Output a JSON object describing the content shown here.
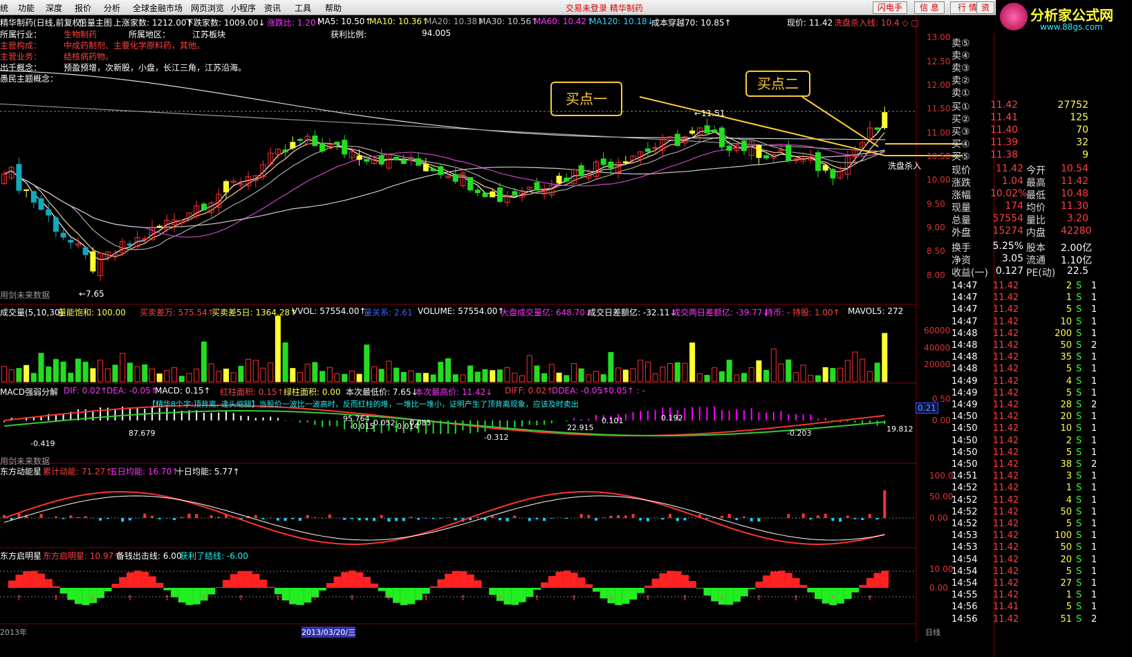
{
  "menu": [
    "统",
    "功能",
    "深度",
    "报价",
    "分析",
    "全球金融市场",
    "网页浏览",
    "小程序",
    "资讯",
    "工具",
    "帮助"
  ],
  "notice": "交易未登录  精华制药",
  "header_buttons": [
    "闪电手",
    "信 息",
    "行 情",
    "资"
  ],
  "logo": {
    "title": "分析家公式网",
    "url": "www.88gs.com"
  },
  "stock_header": {
    "name": "精华制药(日线,前复权)",
    "mult": "倍量主图",
    "up_count": "上涨家数: 1212.00↑",
    "down_count": "下跌家数: 1009.00↓",
    "ratio": "涨跌比: 1.20↑",
    "ma5": "MA5: 10.50↑",
    "ma10": "MA10: 10.36↑",
    "ma20": "MA20: 10.38↑",
    "ma30": "MA30: 10.56↑",
    "ma60": "MA60: 10.42↑",
    "ma120": "MA120: 10.18↓",
    "cost": "成本穿越70: 10.85↑",
    "current": "现价: 11.42",
    "wash": "洗盘杀入线: 10.4 ◇ ▢"
  },
  "info": {
    "industry_label": "所属行业：",
    "industry": "生物制药",
    "region_label": "所属地区：",
    "region": "江苏板块",
    "profit_label": "获利比例:",
    "profit": "94.005",
    "main_label": "主营构成：",
    "main": "中成药制剂、主要化学原料药，其他。",
    "business_label": "主营业务：",
    "business": "结核病药物。",
    "concept_label": "出千概念：",
    "concept": "预盈预增，次新股，小盘，长江三角，江苏沿海。",
    "theme_label": "愚民主题概念："
  },
  "watermark": "用剑未来数据",
  "annotations": {
    "buy1": "买点一",
    "buy2": "买点二",
    "wash_tag": "洗盘杀入",
    "low": "←7.65",
    "high": "←11.51"
  },
  "main_axis": [
    "13.00",
    "12.50",
    "12.00",
    "11.50",
    "11.00",
    "10.50",
    "10.00",
    "9.50",
    "9.00",
    "8.50",
    "8.00"
  ],
  "vol_header": {
    "title": "成交量(5,10,30)",
    "sat": "量能饱和: 100.00",
    "diff": "买卖差万: 575.54↑",
    "diff5": "买卖差5日: 1364.28↑",
    "vvol": "VVOL: 57554.00↑",
    "inflow": "量关系: 2.61",
    "volume": "VOLUME: 57554.00↑",
    "big": "大盘成交量亿: 648.70↓",
    "daydiff": "成交日差额亿: -32.11↓",
    "twoday": "成交两日差额亿: -39.77↓",
    "hold": "持币: -",
    "holdshare": "持股: 1.00↑",
    "mavol": "MAVOL5: 272"
  },
  "vol_axis": [
    "60000",
    "40000",
    "20000"
  ],
  "macd_header": {
    "title": "MACD强弱分解",
    "dif": "DIF: 0.02↑",
    "dea": "DEA: -0.05↑",
    "macd": "MACD: 0.15↑",
    "red": "红柱面积: 0.15↑",
    "green": "绿柱面积: 0.00",
    "low": "本次最低价: 7.65↓",
    "high": "本次最高价: 11.42↓",
    "diff2": "DIFF: 0.02↑",
    "ddea": "DDEA: -0.05↑",
    "extra": ": -0.05↑  : -"
  },
  "macd_note": "【精华8个字:顶背离, 逢头缩腿】当股价一波比一波高时，反而红柱的堆，一堆比一堆小，证明产生了顶背离现象，应该及时卖出",
  "macd_axis": [
    "0.50",
    "0.00"
  ],
  "macd_tag": "0.21",
  "macd_labels": [
    "-0.419",
    "87.679",
    "95.764",
    "-0.015",
    "0.052",
    "-0.014",
    "0.085",
    "-0.312",
    "22.915",
    "0.101",
    "0.192",
    "19.812",
    "-0.203"
  ],
  "dyn_header": {
    "title": "东方动能星",
    "total": "累计动能: 71.27↑",
    "five": "五日均能: 16.70↑",
    "ten": "十日均能: 5.77↑"
  },
  "dyn_axis": [
    "100.0",
    "50.00",
    "0.00"
  ],
  "star_header": {
    "title": "东方启明星",
    "star": "东方启明星: 10.97↑",
    "ready": "备钱出击线: 6.00",
    "profit": "获利了结线: -6.00"
  },
  "star_axis": [
    "10.00",
    "0.00"
  ],
  "bottom": {
    "date": "2013/03/20/三",
    "day": "日线",
    "y1": "2013年"
  },
  "orderbook": {
    "sells": [
      {
        "l": "卖⑤"
      },
      {
        "l": "卖④"
      },
      {
        "l": "卖③"
      },
      {
        "l": "卖②"
      },
      {
        "l": "卖①"
      }
    ],
    "buys": [
      {
        "l": "买①",
        "p": "11.42",
        "v": "27752"
      },
      {
        "l": "买②",
        "p": "11.41",
        "v": "125"
      },
      {
        "l": "买③",
        "p": "11.40",
        "v": "70"
      },
      {
        "l": "买④",
        "p": "11.39",
        "v": "32"
      },
      {
        "l": "买⑤",
        "p": "11.38",
        "v": "9"
      }
    ]
  },
  "quote": [
    {
      "l1": "现价",
      "v1": "11.42",
      "l2": "今开",
      "v2": "10.54"
    },
    {
      "l1": "涨跌",
      "v1": "1.04",
      "l2": "最高",
      "v2": "11.42"
    },
    {
      "l1": "涨幅",
      "v1": "10.02%",
      "l2": "最低",
      "v2": "10.48"
    },
    {
      "l1": "现量",
      "v1": "174",
      "l2": "均价",
      "v2": "11.30"
    },
    {
      "l1": "总量",
      "v1": "57554",
      "l2": "量比",
      "v2": "3.20"
    },
    {
      "l1": "外盘",
      "v1": "15274",
      "l2": "内盘",
      "v2": "42280"
    }
  ],
  "fund": [
    {
      "l1": "换手",
      "v1": "5.25%",
      "l2": "股本",
      "v2": "2.00亿"
    },
    {
      "l1": "净资",
      "v1": "3.05",
      "l2": "流通",
      "v2": "1.10亿"
    },
    {
      "l1": "收益(一)",
      "v1": "0.127",
      "l2": "PE(动)",
      "v2": "22.5"
    }
  ],
  "ticks": [
    {
      "t": "14:47",
      "p": "11.42",
      "v": "2",
      "s": "S",
      "n": "1"
    },
    {
      "t": "14:47",
      "p": "11.42",
      "v": "1",
      "s": "S",
      "n": "1"
    },
    {
      "t": "14:47",
      "p": "11.42",
      "v": "5",
      "s": "S",
      "n": "1"
    },
    {
      "t": "14:47",
      "p": "11.42",
      "v": "10",
      "s": "S",
      "n": "1"
    },
    {
      "t": "14:48",
      "p": "11.42",
      "v": "200",
      "s": "S",
      "n": "1"
    },
    {
      "t": "14:48",
      "p": "11.42",
      "v": "50",
      "s": "S",
      "n": "2"
    },
    {
      "t": "14:48",
      "p": "11.42",
      "v": "35",
      "s": "S",
      "n": "1"
    },
    {
      "t": "14:48",
      "p": "11.42",
      "v": "5",
      "s": "S",
      "n": "1"
    },
    {
      "t": "14:49",
      "p": "11.42",
      "v": "4",
      "s": "S",
      "n": "1"
    },
    {
      "t": "14:49",
      "p": "11.42",
      "v": "5",
      "s": "S",
      "n": "1"
    },
    {
      "t": "14:49",
      "p": "11.42",
      "v": "28",
      "s": "S",
      "n": "2"
    },
    {
      "t": "14:50",
      "p": "11.42",
      "v": "20",
      "s": "S",
      "n": "1"
    },
    {
      "t": "14:50",
      "p": "11.42",
      "v": "10",
      "s": "S",
      "n": "1"
    },
    {
      "t": "14:50",
      "p": "11.42",
      "v": "2",
      "s": "S",
      "n": "1"
    },
    {
      "t": "14:50",
      "p": "11.42",
      "v": "5",
      "s": "S",
      "n": "1"
    },
    {
      "t": "14:50",
      "p": "11.42",
      "v": "38",
      "s": "S",
      "n": "2"
    },
    {
      "t": "14:51",
      "p": "11.42",
      "v": "3",
      "s": "S",
      "n": "1"
    },
    {
      "t": "14:52",
      "p": "11.42",
      "v": "1",
      "s": "S",
      "n": "1"
    },
    {
      "t": "14:52",
      "p": "11.42",
      "v": "4",
      "s": "S",
      "n": "1"
    },
    {
      "t": "14:52",
      "p": "11.42",
      "v": "50",
      "s": "S",
      "n": "1"
    },
    {
      "t": "14:52",
      "p": "11.42",
      "v": "5",
      "s": "S",
      "n": "1"
    },
    {
      "t": "14:53",
      "p": "11.42",
      "v": "100",
      "s": "S",
      "n": "1"
    },
    {
      "t": "14:53",
      "p": "11.42",
      "v": "50",
      "s": "S",
      "n": "1"
    },
    {
      "t": "14:54",
      "p": "11.42",
      "v": "20",
      "s": "S",
      "n": "1"
    },
    {
      "t": "14:54",
      "p": "11.42",
      "v": "5",
      "s": "S",
      "n": "1"
    },
    {
      "t": "14:54",
      "p": "11.42",
      "v": "27",
      "s": "S",
      "n": "1"
    },
    {
      "t": "14:55",
      "p": "11.42",
      "v": "1",
      "s": "S",
      "n": "1"
    },
    {
      "t": "14:56",
      "p": "11.41",
      "v": "5",
      "s": "S",
      "n": "1"
    },
    {
      "t": "14:56",
      "p": "11.42",
      "v": "51",
      "s": "S",
      "n": "2"
    }
  ]
}
